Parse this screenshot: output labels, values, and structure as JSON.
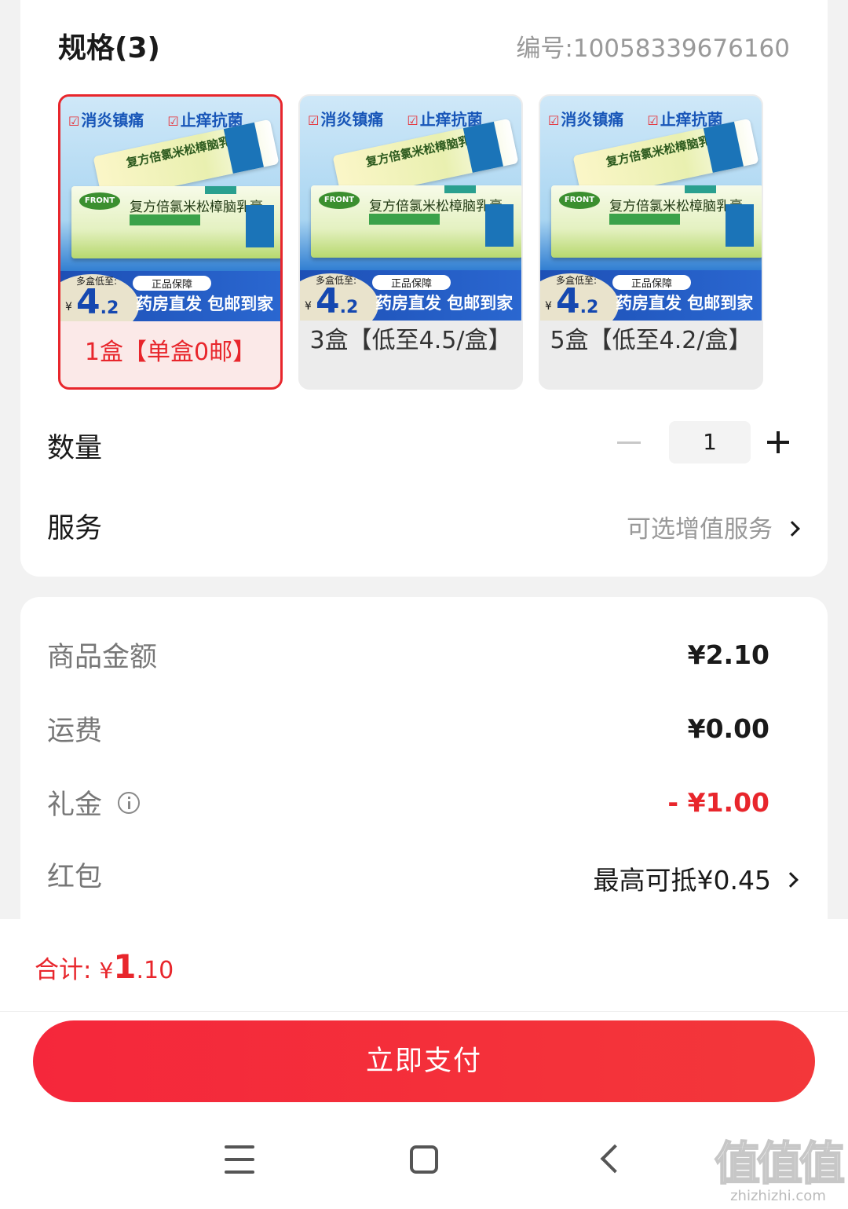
{
  "spec": {
    "title": "规格(3)",
    "code": "编号:10058339676160",
    "items": [
      {
        "label": "1盒【单盒0邮】",
        "selected": true
      },
      {
        "label": "3盒【低至4.5/盒】",
        "selected": false
      },
      {
        "label": "5盒【低至4.2/盒】",
        "selected": false
      }
    ],
    "thumb": {
      "tag1": "消炎镇痛",
      "tag2": "止痒抗菌",
      "product_name": "复方倍氯米松樟脑乳膏",
      "back_tube_name": "复方倍氯米松樟脑乳膏",
      "brand_logo": "FRONT",
      "low_label": "多盒低至:",
      "yen": "¥",
      "big_price": "4",
      "small_price": ".2",
      "guarantee": "正品保障",
      "slogan": "药房直发 包邮到家"
    }
  },
  "quantity": {
    "label": "数量",
    "value": "1"
  },
  "service": {
    "label": "服务",
    "value": "可选增值服务"
  },
  "fees": {
    "goods_label": "商品金额",
    "goods_value": "¥2.10",
    "shipping_label": "运费",
    "shipping_value": "¥0.00",
    "gift_label": "礼金",
    "gift_value": "- ¥1.00",
    "redpack_label": "红包",
    "redpack_value": "最高可抵¥0.45"
  },
  "total": {
    "label": "合计:",
    "yen": "¥",
    "int": "1",
    "dec": ".10"
  },
  "pay_button": "立即支付",
  "watermark": {
    "glyphs": "值值值",
    "site": "zhizhizhi.com"
  },
  "colors": {
    "accent": "#e8262c",
    "pay_button": "#f5273b"
  }
}
